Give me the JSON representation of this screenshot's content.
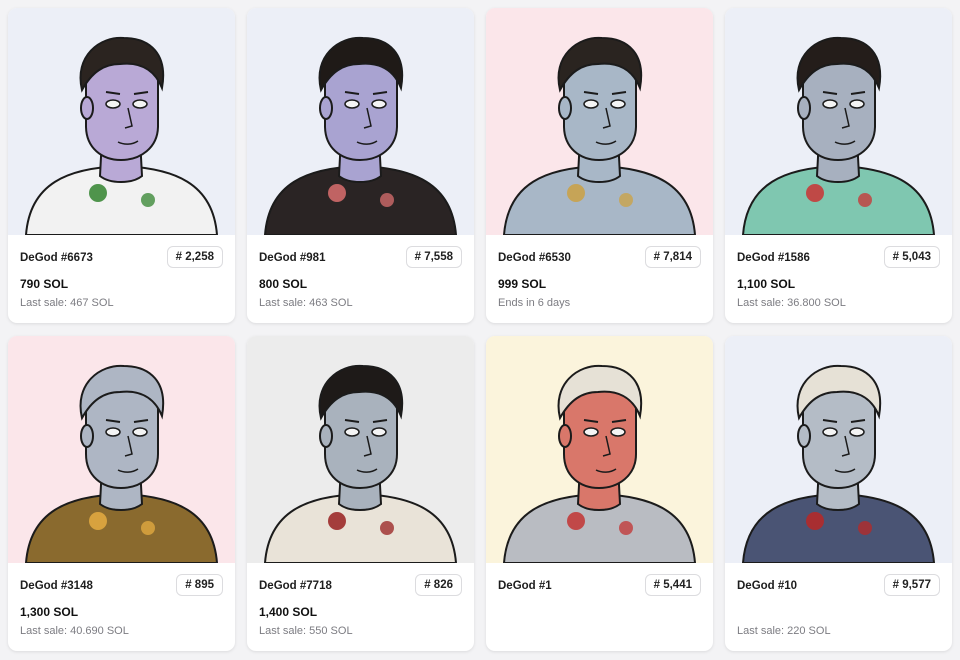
{
  "cards": [
    {
      "name": "DeGod #6673",
      "rank": "# 2,258",
      "price": "790 SOL",
      "sub": "Last sale: 467 SOL",
      "bg": "#eceff7",
      "skin": "#b9a9d6",
      "hair": "#2b2420",
      "shirt": "#f2f2f2",
      "accent": "#3d8a3a",
      "art": "degod-6673-art"
    },
    {
      "name": "DeGod #981",
      "rank": "# 7,558",
      "price": "800 SOL",
      "sub": "Last sale: 463 SOL",
      "bg": "#eceff7",
      "skin": "#a9a3d1",
      "hair": "#1f1a17",
      "shirt": "#2a2424",
      "accent": "#d06a6a",
      "art": "degod-981-art"
    },
    {
      "name": "DeGod #6530",
      "rank": "# 7,814",
      "price": "999 SOL",
      "sub": "Ends in 6 days",
      "bg": "#fbe6ea",
      "skin": "#a8b7c7",
      "hair": "#2a2420",
      "shirt": "#a8b7c7",
      "accent": "#c9a24a",
      "art": "degod-6530-art"
    },
    {
      "name": "DeGod #1586",
      "rank": "# 5,043",
      "price": "1,100 SOL",
      "sub": "Last sale: 36.800 SOL",
      "bg": "#eceff7",
      "skin": "#a7b0bf",
      "hair": "#241d1a",
      "shirt": "#7fc7b0",
      "accent": "#c63b3b",
      "art": "degod-1586-art"
    },
    {
      "name": "DeGod #3148",
      "rank": "# 895",
      "price": "1,300 SOL",
      "sub": "Last sale: 40.690 SOL",
      "bg": "#fbe6ea",
      "skin": "#aeb6c4",
      "hair": "#aeb6c4",
      "shirt": "#8a6a2e",
      "accent": "#e0a940",
      "art": "degod-3148-art"
    },
    {
      "name": "DeGod #7718",
      "rank": "# 826",
      "price": "1,400 SOL",
      "sub": "Last sale: 550 SOL",
      "bg": "#ececec",
      "skin": "#a9b2bd",
      "hair": "#1e1a18",
      "shirt": "#e9e3d8",
      "accent": "#9c2a2a",
      "art": "degod-7718-art"
    },
    {
      "name": "DeGod #1",
      "rank": "# 5,441",
      "price": "",
      "sub": "",
      "bg": "#fbf4dc",
      "skin": "#d9776a",
      "hair": "#e6e1d6",
      "shirt": "#b9bcc2",
      "accent": "#c23b3b",
      "art": "degod-1-art"
    },
    {
      "name": "DeGod #10",
      "rank": "# 9,577",
      "price": "",
      "sub": "Last sale: 220 SOL",
      "bg": "#eceff7",
      "skin": "#b4bcc6",
      "hair": "#e6e1d6",
      "shirt": "#4a5474",
      "accent": "#b22a2a",
      "art": "degod-10-art"
    }
  ]
}
